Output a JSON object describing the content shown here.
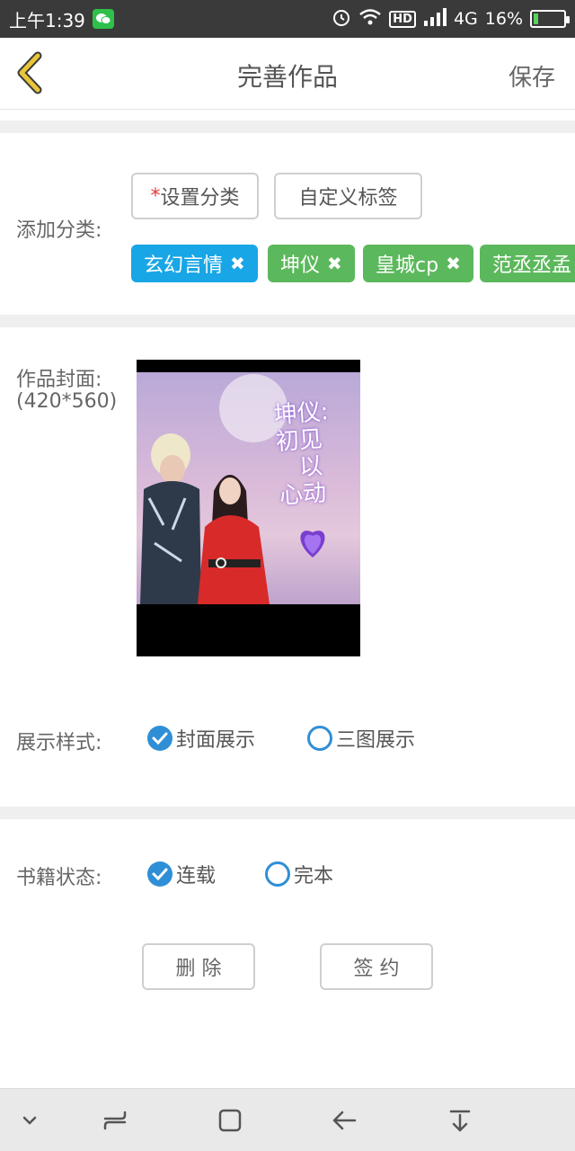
{
  "status_bar": {
    "time": "上午1:39",
    "hd": "HD",
    "network": "4G",
    "battery": "16%",
    "battery_level": 0.16
  },
  "header": {
    "title": "完善作品",
    "save": "保存"
  },
  "classification": {
    "label": "添加分类:",
    "required_mark": "*",
    "set_category": "设置分类",
    "custom_tag": "自定义标签",
    "tags": [
      {
        "text": "玄幻言情",
        "color": "#18a6e6"
      },
      {
        "text": "坤仪",
        "color": "#5cb85c"
      },
      {
        "text": "皇城cp",
        "color": "#5cb85c"
      },
      {
        "text": "范丞丞孟",
        "color": "#5cb85c"
      }
    ]
  },
  "cover": {
    "label": "作品封面:",
    "size_hint": "(420*560)",
    "art_text": [
      "坤仪:",
      "初见",
      "以",
      "心动"
    ]
  },
  "display_style": {
    "label": "展示样式:",
    "options": [
      "封面展示",
      "三图展示"
    ],
    "selected": "封面展示"
  },
  "book_status": {
    "label": "书籍状态:",
    "options": [
      "连载",
      "完本"
    ],
    "selected": "连载"
  },
  "actions": {
    "delete": "删 除",
    "sign": "签 约"
  },
  "colors": {
    "accent_blue": "#2f8fd6",
    "tag_blue": "#18a6e6",
    "tag_green": "#5cb85c",
    "back_arrow": "#e8c53a"
  }
}
